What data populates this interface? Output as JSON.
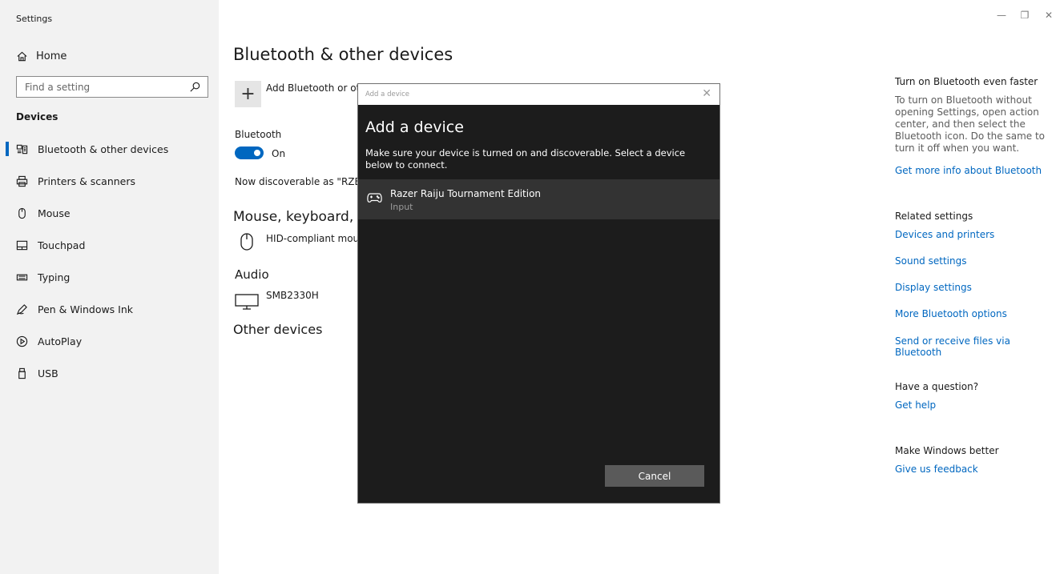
{
  "window": {
    "title": "Settings",
    "controls": {
      "minimize": "—",
      "restore": "❐",
      "close": "✕"
    }
  },
  "sidebar": {
    "home_label": "Home",
    "search_placeholder": "Find a setting",
    "section_label": "Devices",
    "items": [
      {
        "label": "Bluetooth & other devices",
        "icon": "bluetooth-devices-icon",
        "active": true
      },
      {
        "label": "Printers & scanners",
        "icon": "printer-icon",
        "active": false
      },
      {
        "label": "Mouse",
        "icon": "mouse-icon",
        "active": false
      },
      {
        "label": "Touchpad",
        "icon": "touchpad-icon",
        "active": false
      },
      {
        "label": "Typing",
        "icon": "keyboard-icon",
        "active": false
      },
      {
        "label": "Pen & Windows Ink",
        "icon": "pen-icon",
        "active": false
      },
      {
        "label": "AutoPlay",
        "icon": "autoplay-icon",
        "active": false
      },
      {
        "label": "USB",
        "icon": "usb-icon",
        "active": false
      }
    ]
  },
  "main": {
    "title": "Bluetooth & other devices",
    "add_button_label": "Add Bluetooth or other device",
    "bluetooth_label": "Bluetooth",
    "toggle_state": "On",
    "discoverable_text": "Now discoverable as \"RZB-S",
    "mouse_heading": "Mouse, keyboard, & pen",
    "mouse_device": "HID-compliant mouse",
    "audio_heading": "Audio",
    "audio_device": "SMB2330H",
    "other_heading": "Other devices"
  },
  "right_panel": {
    "faster_heading": "Turn on Bluetooth even faster",
    "faster_text": "To turn on Bluetooth without opening Settings, open action center, and then select the Bluetooth icon. Do the same to turn it off when you want.",
    "faster_link": "Get more info about Bluetooth",
    "related_heading": "Related settings",
    "related_links": [
      "Devices and printers",
      "Sound settings",
      "Display settings",
      "More Bluetooth options",
      "Send or receive files via Bluetooth"
    ],
    "question_heading": "Have a question?",
    "question_link": "Get help",
    "better_heading": "Make Windows better",
    "better_link": "Give us feedback"
  },
  "dialog": {
    "window_title": "Add a device",
    "close": "✕",
    "heading": "Add a device",
    "description": "Make sure your device is turned on and discoverable. Select a device below to connect.",
    "devices": [
      {
        "name": "Razer Raiju Tournament Edition",
        "type": "Input",
        "icon": "gamepad-icon"
      }
    ],
    "cancel_label": "Cancel"
  },
  "colors": {
    "accent": "#0067c0",
    "sidebar_bg": "#f2f2f2",
    "dialog_bg": "#1c1c1c",
    "dialog_item_bg": "#333333",
    "cancel_bg": "#5a5a5a"
  }
}
